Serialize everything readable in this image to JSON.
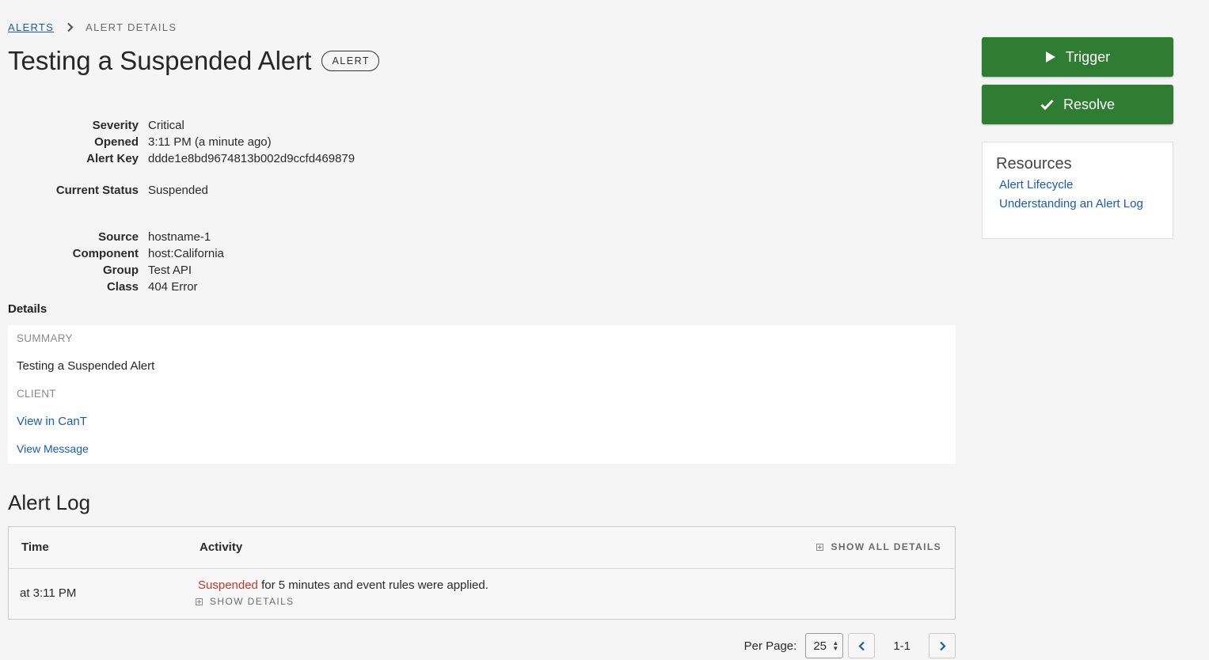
{
  "breadcrumb": {
    "parent": "ALERTS",
    "current": "ALERT DETAILS"
  },
  "header": {
    "title": "Testing a Suspended Alert",
    "badge": "ALERT"
  },
  "properties": {
    "severity": {
      "label": "Severity",
      "value": "Critical"
    },
    "opened": {
      "label": "Opened",
      "value": "3:11 PM (a minute ago)"
    },
    "alert_key": {
      "label": "Alert Key",
      "value": "ddde1e8bd9674813b002d9ccfd469879"
    },
    "current_status": {
      "label": "Current Status",
      "value": "Suspended"
    },
    "source": {
      "label": "Source",
      "value": "hostname-1"
    },
    "component": {
      "label": "Component",
      "value": "host:California"
    },
    "group": {
      "label": "Group",
      "value": "Test API"
    },
    "class": {
      "label": "Class",
      "value": "404 Error"
    }
  },
  "details": {
    "heading": "Details",
    "summary_label": "SUMMARY",
    "summary_value": "Testing a Suspended Alert",
    "client_label": "CLIENT",
    "client_link": "View in CanT",
    "message_link": "View Message"
  },
  "alert_log": {
    "heading": "Alert Log",
    "columns": {
      "time": "Time",
      "activity": "Activity"
    },
    "show_all_details": "SHOW ALL DETAILS",
    "rows": [
      {
        "time": "at 3:11 PM",
        "status_word": "Suspended",
        "activity_rest": " for 5 minutes and event rules were applied.",
        "show_details": "SHOW DETAILS"
      }
    ]
  },
  "pagination": {
    "per_page_label": "Per Page:",
    "per_page_value": "25",
    "range": "1-1"
  },
  "actions": {
    "trigger": "Trigger",
    "resolve": "Resolve"
  },
  "resources": {
    "title": "Resources",
    "links": [
      "Alert Lifecycle",
      "Understanding an Alert Log"
    ]
  },
  "colors": {
    "action_green": "#2e7d32",
    "link_blue": "#1a5bb8",
    "status_red": "#c0392b"
  },
  "icons": {
    "trigger": "play-icon",
    "resolve": "check-icon",
    "breadcrumb_separator": "chevron-right-icon",
    "prev": "chevron-left-icon",
    "next": "chevron-right-icon",
    "expand": "plus-square-icon"
  }
}
